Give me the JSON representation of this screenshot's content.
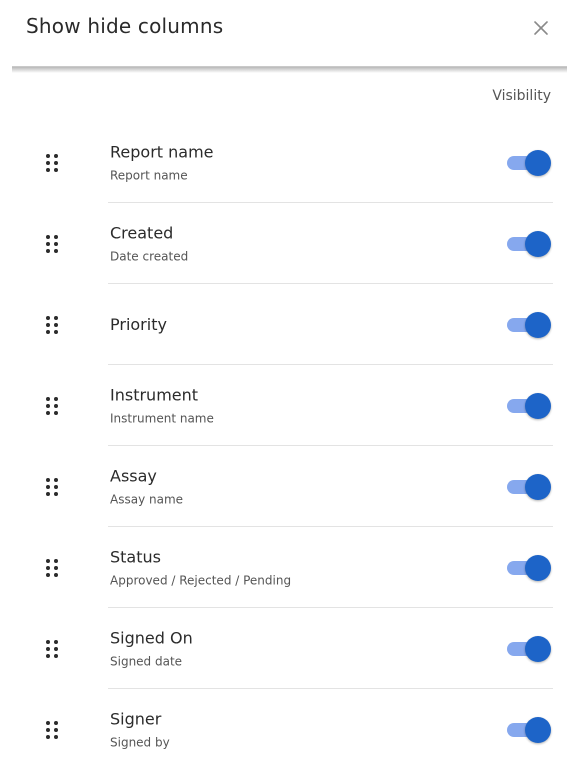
{
  "dialog": {
    "title": "Show hide columns",
    "close_icon": "close-icon",
    "visibility_header": "Visibility"
  },
  "columns": [
    {
      "label": "Report name",
      "sublabel": "Report name",
      "visible": true
    },
    {
      "label": "Created",
      "sublabel": "Date created",
      "visible": true
    },
    {
      "label": "Priority",
      "sublabel": "",
      "visible": true
    },
    {
      "label": "Instrument",
      "sublabel": "Instrument name",
      "visible": true
    },
    {
      "label": "Assay",
      "sublabel": "Assay name",
      "visible": true
    },
    {
      "label": "Status",
      "sublabel": "Approved / Rejected / Pending",
      "visible": true
    },
    {
      "label": "Signed On",
      "sublabel": "Signed date",
      "visible": true
    },
    {
      "label": "Signer",
      "sublabel": "Signed by",
      "visible": true
    }
  ],
  "colors": {
    "toggle_track": "#86a8ee",
    "toggle_knob": "#1d64c8"
  }
}
